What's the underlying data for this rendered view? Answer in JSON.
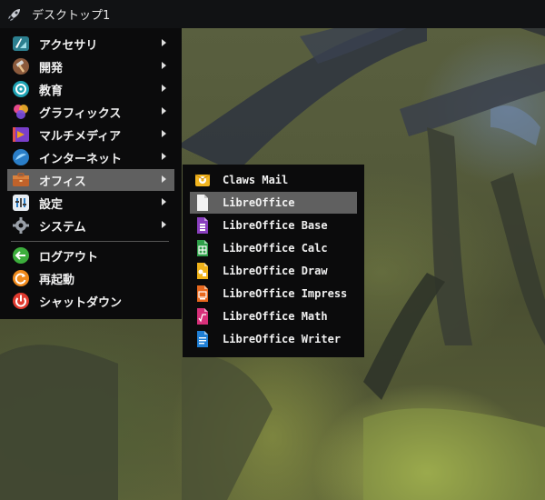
{
  "panel": {
    "title": "デスクトップ1",
    "icon": "rocket-icon"
  },
  "menu": {
    "items": [
      {
        "label": "アクセサリ",
        "icon": "accessories-icon",
        "submenu": true
      },
      {
        "label": "開発",
        "icon": "hammer-icon",
        "submenu": true
      },
      {
        "label": "教育",
        "icon": "education-icon",
        "submenu": true
      },
      {
        "label": "グラフィックス",
        "icon": "graphics-icon",
        "submenu": true
      },
      {
        "label": "マルチメディア",
        "icon": "multimedia-icon",
        "submenu": true
      },
      {
        "label": "インターネット",
        "icon": "internet-icon",
        "submenu": true
      },
      {
        "label": "オフィス",
        "icon": "office-icon",
        "submenu": true,
        "selected": true
      },
      {
        "label": "設定",
        "icon": "settings-icon",
        "submenu": true
      },
      {
        "label": "システム",
        "icon": "gear-icon",
        "submenu": true
      }
    ],
    "session": [
      {
        "label": "ログアウト",
        "icon": "logout-icon"
      },
      {
        "label": "再起動",
        "icon": "restart-icon"
      },
      {
        "label": "シャットダウン",
        "icon": "power-icon"
      }
    ]
  },
  "submenu": {
    "items": [
      {
        "label": "Claws Mail",
        "icon": "mail-icon"
      },
      {
        "label": "LibreOffice",
        "icon": "document-icon",
        "selected": true
      },
      {
        "label": "LibreOffice Base",
        "icon": "base-icon"
      },
      {
        "label": "LibreOffice Calc",
        "icon": "calc-icon"
      },
      {
        "label": "LibreOffice Draw",
        "icon": "draw-icon"
      },
      {
        "label": "LibreOffice Impress",
        "icon": "impress-icon"
      },
      {
        "label": "LibreOffice Math",
        "icon": "math-icon"
      },
      {
        "label": "LibreOffice Writer",
        "icon": "writer-icon"
      }
    ]
  },
  "colors": {
    "menu_bg": "#0b0b0c",
    "highlight": "#606060",
    "panel_bg": "#111214"
  }
}
